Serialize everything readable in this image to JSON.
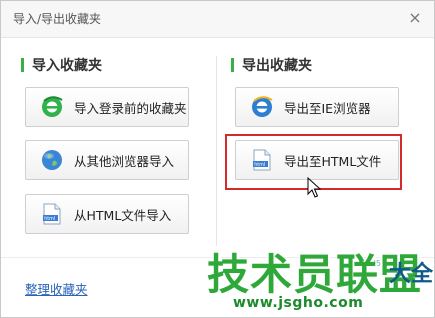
{
  "dialog": {
    "title": "导入/导出收藏夹",
    "close_glyph": "×"
  },
  "import_section": {
    "heading": "导入收藏夹",
    "buttons": [
      {
        "label": "导入登录前的收藏夹",
        "icon": "ie-green-icon"
      },
      {
        "label": "从其他浏览器导入",
        "icon": "globe-icon"
      },
      {
        "label": "从HTML文件导入",
        "icon": "html-file-icon"
      }
    ]
  },
  "export_section": {
    "heading": "导出收藏夹",
    "buttons": [
      {
        "label": "导出至IE浏览器",
        "icon": "ie-blue-icon"
      },
      {
        "label": "导出至HTML文件",
        "icon": "html-file-icon"
      }
    ]
  },
  "footer": {
    "manage_link": "整理收藏夹"
  },
  "watermark": {
    "main": "技术员联盟",
    "url": "www.jsgho.com",
    "side": "大全",
    "small": "P85.COM"
  },
  "colors": {
    "accent_green": "#38b048",
    "highlight_red": "#d42a2a",
    "link_blue": "#2a63b8"
  }
}
